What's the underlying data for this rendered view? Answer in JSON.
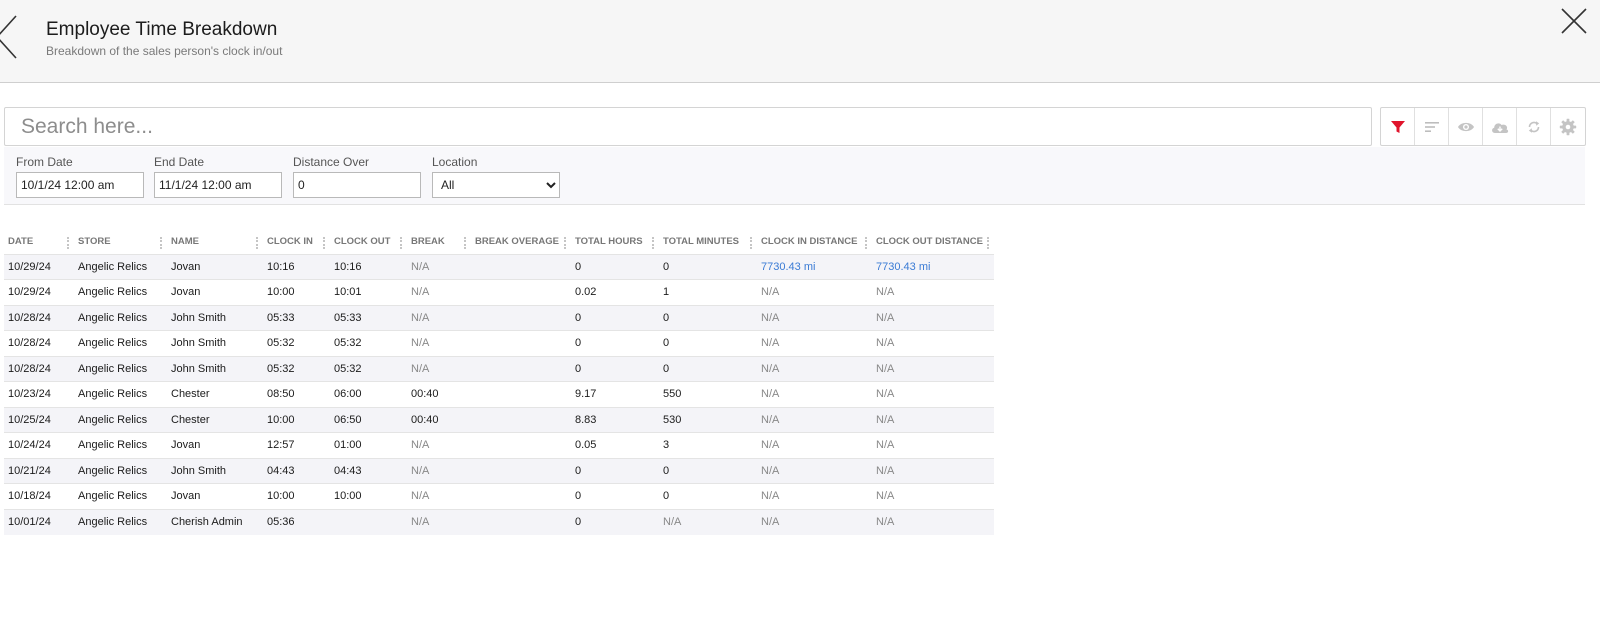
{
  "header": {
    "title": "Employee Time Breakdown",
    "subtitle": "Breakdown of the sales person's clock in/out"
  },
  "search": {
    "placeholder": "Search here..."
  },
  "toolbar": {
    "buttons": [
      "filter-icon",
      "sort-icon",
      "eye-icon",
      "cloud-download-icon",
      "refresh-icon",
      "gear-icon"
    ],
    "accent": "#e0142c",
    "icon_color": "#c4c4c4"
  },
  "filters": {
    "from_date": {
      "label": "From Date",
      "value": "10/1/24 12:00 am"
    },
    "end_date": {
      "label": "End Date",
      "value": "11/1/24 12:00 am"
    },
    "distance_over": {
      "label": "Distance Over",
      "value": "0"
    },
    "location": {
      "label": "Location",
      "value": "All"
    }
  },
  "table": {
    "columns": [
      "DATE",
      "STORE",
      "NAME",
      "CLOCK IN",
      "CLOCK OUT",
      "BREAK",
      "BREAK OVERAGE",
      "TOTAL HOURS",
      "TOTAL MINUTES",
      "CLOCK IN DISTANCE",
      "CLOCK OUT DISTANCE"
    ],
    "rows": [
      [
        "10/29/24",
        "Angelic Relics",
        "Jovan",
        "10:16",
        "10:16",
        "N/A",
        "",
        "0",
        "0",
        "7730.43 mi",
        "7730.43 mi"
      ],
      [
        "10/29/24",
        "Angelic Relics",
        "Jovan",
        "10:00",
        "10:01",
        "N/A",
        "",
        "0.02",
        "1",
        "N/A",
        "N/A"
      ],
      [
        "10/28/24",
        "Angelic Relics",
        "John Smith",
        "05:33",
        "05:33",
        "N/A",
        "",
        "0",
        "0",
        "N/A",
        "N/A"
      ],
      [
        "10/28/24",
        "Angelic Relics",
        "John Smith",
        "05:32",
        "05:32",
        "N/A",
        "",
        "0",
        "0",
        "N/A",
        "N/A"
      ],
      [
        "10/28/24",
        "Angelic Relics",
        "John Smith",
        "05:32",
        "05:32",
        "N/A",
        "",
        "0",
        "0",
        "N/A",
        "N/A"
      ],
      [
        "10/23/24",
        "Angelic Relics",
        "Chester",
        "08:50",
        "06:00",
        "00:40",
        "",
        "9.17",
        "550",
        "N/A",
        "N/A"
      ],
      [
        "10/25/24",
        "Angelic Relics",
        "Chester",
        "10:00",
        "06:50",
        "00:40",
        "",
        "8.83",
        "530",
        "N/A",
        "N/A"
      ],
      [
        "10/24/24",
        "Angelic Relics",
        "Jovan",
        "12:57",
        "01:00",
        "N/A",
        "",
        "0.05",
        "3",
        "N/A",
        "N/A"
      ],
      [
        "10/21/24",
        "Angelic Relics",
        "John Smith",
        "04:43",
        "04:43",
        "N/A",
        "",
        "0",
        "0",
        "N/A",
        "N/A"
      ],
      [
        "10/18/24",
        "Angelic Relics",
        "Jovan",
        "10:00",
        "10:00",
        "N/A",
        "",
        "0",
        "0",
        "N/A",
        "N/A"
      ],
      [
        "10/01/24",
        "Angelic Relics",
        "Cherish Admin",
        "05:36",
        "",
        "N/A",
        "",
        "0",
        "N/A",
        "N/A",
        "N/A"
      ]
    ]
  }
}
